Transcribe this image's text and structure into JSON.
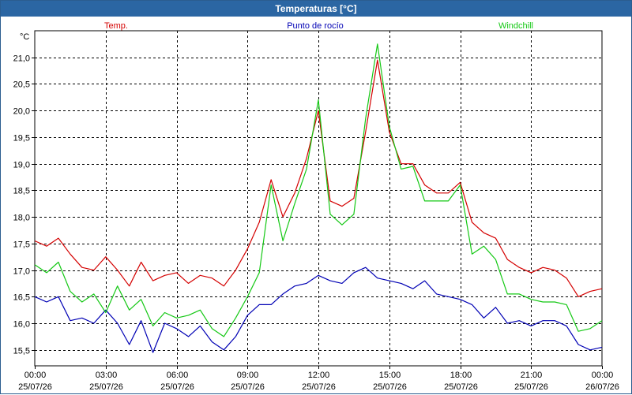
{
  "window": {
    "title": "Temperaturas [°C]"
  },
  "chart_data": {
    "type": "line",
    "title": "Temperaturas [°C]",
    "ylabel": "°C",
    "ylim": [
      15.2,
      21.5
    ],
    "grid": true,
    "legend_position": "top",
    "y_ticks": [
      "15,5",
      "16,0",
      "16,5",
      "17,0",
      "17,5",
      "18,0",
      "18,5",
      "19,0",
      "19,5",
      "20,0",
      "20,5",
      "21,0"
    ],
    "y_tick_values": [
      15.5,
      16.0,
      16.5,
      17.0,
      17.5,
      18.0,
      18.5,
      19.0,
      19.5,
      20.0,
      20.5,
      21.0
    ],
    "x_ticks": [
      {
        "time": "00:00",
        "date": "25/07/26"
      },
      {
        "time": "03:00",
        "date": "25/07/26"
      },
      {
        "time": "06:00",
        "date": "25/07/26"
      },
      {
        "time": "09:00",
        "date": "25/07/26"
      },
      {
        "time": "12:00",
        "date": "25/07/26"
      },
      {
        "time": "15:00",
        "date": "25/07/26"
      },
      {
        "time": "18:00",
        "date": "25/07/26"
      },
      {
        "time": "21:00",
        "date": "25/07/26"
      },
      {
        "time": "00:00",
        "date": "26/07/26"
      }
    ],
    "x_hours": [
      0,
      0.5,
      1,
      1.5,
      2,
      2.5,
      3,
      3.5,
      4,
      4.5,
      5,
      5.5,
      6,
      6.5,
      7,
      7.5,
      8,
      8.5,
      9,
      9.5,
      10,
      10.5,
      11,
      11.5,
      12,
      12.5,
      13,
      13.5,
      14,
      14.5,
      15,
      15.5,
      16,
      16.5,
      17,
      17.5,
      18,
      18.5,
      19,
      19.5,
      20,
      20.5,
      21,
      21.5,
      22,
      22.5,
      23,
      23.5,
      24
    ],
    "series": [
      {
        "name": "Temp.",
        "color": "#d40000",
        "values": [
          17.55,
          17.45,
          17.6,
          17.3,
          17.05,
          17.0,
          17.25,
          17.0,
          16.7,
          17.15,
          16.8,
          16.9,
          16.95,
          16.75,
          16.9,
          16.85,
          16.7,
          17.0,
          17.4,
          17.9,
          18.7,
          18.0,
          18.45,
          19.1,
          20.0,
          18.3,
          18.2,
          18.35,
          19.6,
          20.95,
          19.6,
          19.0,
          19.0,
          18.6,
          18.45,
          18.45,
          18.65,
          17.9,
          17.7,
          17.6,
          17.2,
          17.05,
          16.95,
          17.05,
          17.0,
          16.85,
          16.5,
          16.6,
          16.65
        ]
      },
      {
        "name": "Punto de rocío",
        "color": "#0000b4",
        "values": [
          16.5,
          16.4,
          16.5,
          16.05,
          16.1,
          16.0,
          16.25,
          16.0,
          15.6,
          16.05,
          15.45,
          16.0,
          15.9,
          15.75,
          15.95,
          15.65,
          15.5,
          15.75,
          16.15,
          16.35,
          16.35,
          16.55,
          16.7,
          16.75,
          16.9,
          16.8,
          16.75,
          16.95,
          17.05,
          16.85,
          16.8,
          16.75,
          16.65,
          16.8,
          16.55,
          16.5,
          16.45,
          16.35,
          16.1,
          16.3,
          16.0,
          16.05,
          15.95,
          16.05,
          16.05,
          15.95,
          15.6,
          15.5,
          15.55
        ]
      },
      {
        "name": "Windchill",
        "color": "#14c814",
        "values": [
          17.1,
          16.95,
          17.15,
          16.6,
          16.4,
          16.55,
          16.2,
          16.7,
          16.25,
          16.45,
          15.95,
          16.2,
          16.1,
          16.15,
          16.25,
          15.9,
          15.75,
          16.1,
          16.5,
          16.95,
          18.6,
          17.55,
          18.25,
          18.9,
          20.2,
          18.05,
          17.85,
          18.05,
          19.85,
          21.25,
          19.7,
          18.9,
          18.95,
          18.3,
          18.3,
          18.3,
          18.6,
          17.3,
          17.45,
          17.2,
          16.55,
          16.55,
          16.45,
          16.4,
          16.4,
          16.35,
          15.85,
          15.9,
          16.05
        ]
      }
    ]
  }
}
